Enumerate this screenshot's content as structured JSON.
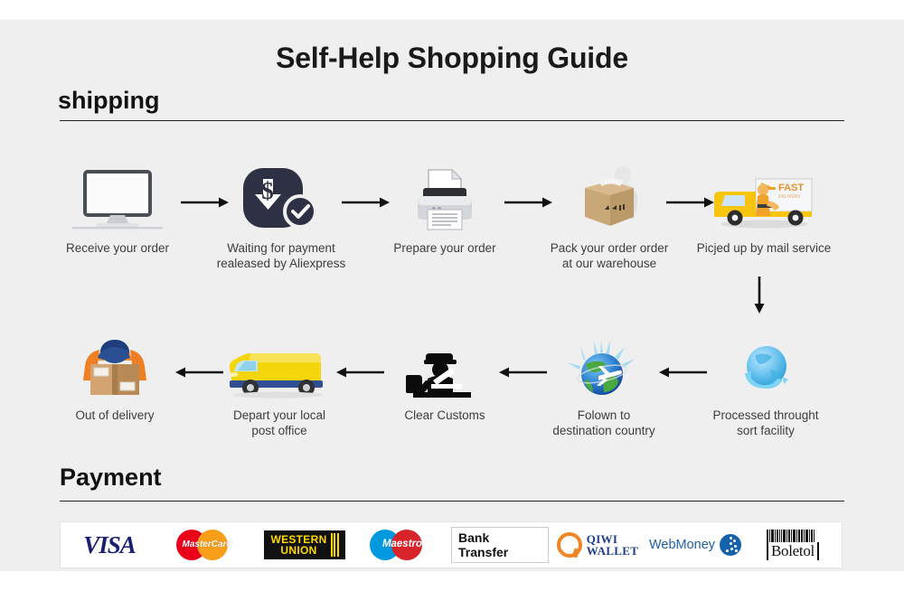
{
  "page": {
    "title": "Self-Help Shopping Guide",
    "background_color": "#efefef",
    "text_color": "#3d3d3d"
  },
  "sections": {
    "shipping": {
      "heading": "shipping"
    },
    "payment": {
      "heading": "Payment"
    }
  },
  "shipping_steps": {
    "row1": [
      {
        "label": "Receive your order",
        "icon": "monitor-icon"
      },
      {
        "label": "Waiting for payment\nrealeased by Aliexpress",
        "line1": "Waiting for payment",
        "line2": "realeased by Aliexpress",
        "icon": "payment-pending-icon"
      },
      {
        "label": "Prepare your order",
        "icon": "printer-icon"
      },
      {
        "label": "Pack your order order\nat our warehouse",
        "line1": "Pack your order order",
        "line2": "at our warehouse",
        "icon": "packing-box-icon"
      },
      {
        "label": "Picjed up by mail service",
        "line1": "Picjed up by mail service",
        "line2": "",
        "icon": "delivery-truck-icon"
      }
    ],
    "row2": [
      {
        "label": "Out of delivery",
        "line1": "Out of delivery",
        "line2": "",
        "icon": "courier-package-icon"
      },
      {
        "label": "Depart your local\npost office",
        "line1": "Depart your local",
        "line2": "post office",
        "icon": "yellow-van-icon"
      },
      {
        "label": "Clear Customs",
        "line1": "Clear Customs",
        "line2": "",
        "icon": "customs-officer-icon"
      },
      {
        "label": "Folown to\ndestination country",
        "line1": "Folown to",
        "line2": "destination country",
        "icon": "globe-airplane-icon"
      },
      {
        "label": "Processed throught\nsort facility",
        "line1": "Processed throught",
        "line2": "sort facility",
        "icon": "globe-sorting-icon"
      }
    ],
    "flow_direction_row1": "left-to-right",
    "flow_direction_row2": "right-to-left",
    "connector_between_rows": "down-arrow"
  },
  "payment_methods": [
    {
      "name": "Visa",
      "label": "VISA",
      "color": "#1a1f71"
    },
    {
      "name": "MasterCard",
      "label": "MasterCard",
      "color_left": "#eb001b",
      "color_right": "#f79e1b"
    },
    {
      "name": "Western Union",
      "label_line1": "WESTERN",
      "label_line2": "UNION",
      "color": "#ffd900",
      "background": "#111111"
    },
    {
      "name": "Maestro",
      "label": "Maestro",
      "color_left": "#0099df",
      "color_right": "#d8232a"
    },
    {
      "name": "Bank Transfer",
      "label": "Bank Transfer",
      "color": "#111111"
    },
    {
      "name": "QIWI Wallet",
      "label_line1": "QIWI",
      "label_line2": "WALLET",
      "color": "#1d3f8b",
      "accent": "#f08522"
    },
    {
      "name": "WebMoney",
      "label": "WebMoney",
      "color": "#1d5fa8"
    },
    {
      "name": "Boleto",
      "label": "Boletol",
      "color": "#111111"
    }
  ]
}
